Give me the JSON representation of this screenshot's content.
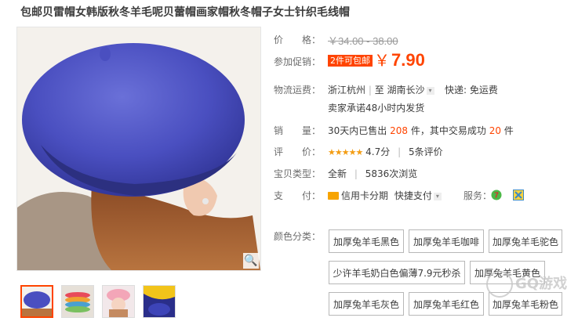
{
  "product": {
    "title": "包邮贝雷帽女韩版秋冬羊毛呢贝蕾帽画家帽秋冬帽子女士针织毛线帽"
  },
  "gallery": {
    "zoom_icon": "magnifier-icon",
    "thumbnails": [
      "blue-beret",
      "colorful-berets",
      "pink-beret-girl",
      "blue-yellow-hat"
    ]
  },
  "price": {
    "label": "价　　格：",
    "original": "￥34.00 - 38.00"
  },
  "promo": {
    "label": "参加促销：",
    "badge": "2件可包邮",
    "currency": "￥",
    "price": "7.90"
  },
  "shipping": {
    "label": "物流运费：",
    "from": "浙江杭州",
    "to": "至  湖南长沙",
    "method": "快递: 免运费",
    "promise": "卖家承诺48小时内发货"
  },
  "sales": {
    "label": "销　　量：",
    "prefix": "30天内已售出",
    "sold": "208",
    "mid": "件，其中交易成功",
    "success": "20",
    "suffix": "件"
  },
  "rating": {
    "label": "评　　价：",
    "stars": "★★★★★",
    "score": "4.7分",
    "reviews": "5条评价"
  },
  "item_type": {
    "label": "宝贝类型：",
    "condition": "全新",
    "views": "5836次浏览"
  },
  "payment": {
    "label": "支　　付：",
    "credit": "信用卡分期",
    "quick": "快捷支付",
    "service_label": "服务："
  },
  "colors": {
    "label": "颜色分类：",
    "options": [
      "加厚兔羊毛黑色",
      "加厚兔羊毛咖啡",
      "加厚兔羊毛驼色",
      "少许羊毛奶白色偏薄7.9元秒杀",
      "加厚兔羊毛黄色",
      "加厚兔羊毛灰色",
      "加厚兔羊毛红色",
      "加厚兔羊毛粉色"
    ]
  },
  "watermark": "GQ游戏",
  "theme": {
    "accent": "#ff4400",
    "beret": "#4a4fc0",
    "star": "#f39d14"
  }
}
